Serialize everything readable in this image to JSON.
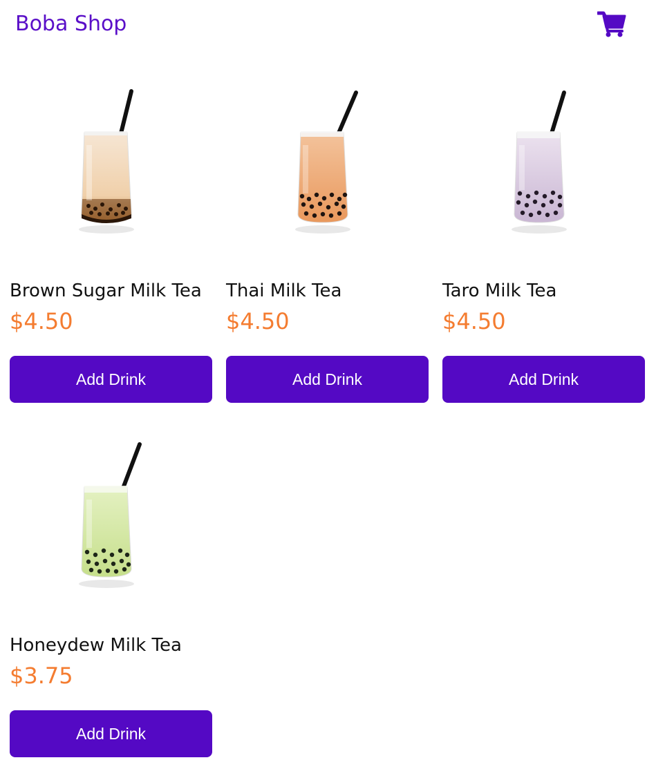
{
  "header": {
    "brand": "Boba Shop",
    "cart_icon": "cart-icon",
    "accent_color": "#5a0fc8"
  },
  "products": [
    {
      "name": "Brown Sugar Milk Tea",
      "price": "$4.50",
      "button": "Add Drink",
      "liquid_top": "#f6e6d4",
      "liquid_bottom": "#e9b982",
      "base_color": "#2a1608"
    },
    {
      "name": "Thai Milk Tea",
      "price": "$4.50",
      "button": "Add Drink",
      "liquid_top": "#f2b88c",
      "liquid_bottom": "#ea9f66",
      "base_color": "#3a2010"
    },
    {
      "name": "Taro Milk Tea",
      "price": "$4.50",
      "button": "Add Drink",
      "liquid_top": "#e9dcec",
      "liquid_bottom": "#cdbad6",
      "base_color": "#2c1f30"
    },
    {
      "name": "Honeydew Milk Tea",
      "price": "$3.75",
      "button": "Add Drink",
      "liquid_top": "#e1efbc",
      "liquid_bottom": "#c7e08e",
      "base_color": "#223018"
    }
  ],
  "colors": {
    "price": "#f47c30",
    "button_bg": "#5409c4",
    "button_text": "#ffffff"
  }
}
